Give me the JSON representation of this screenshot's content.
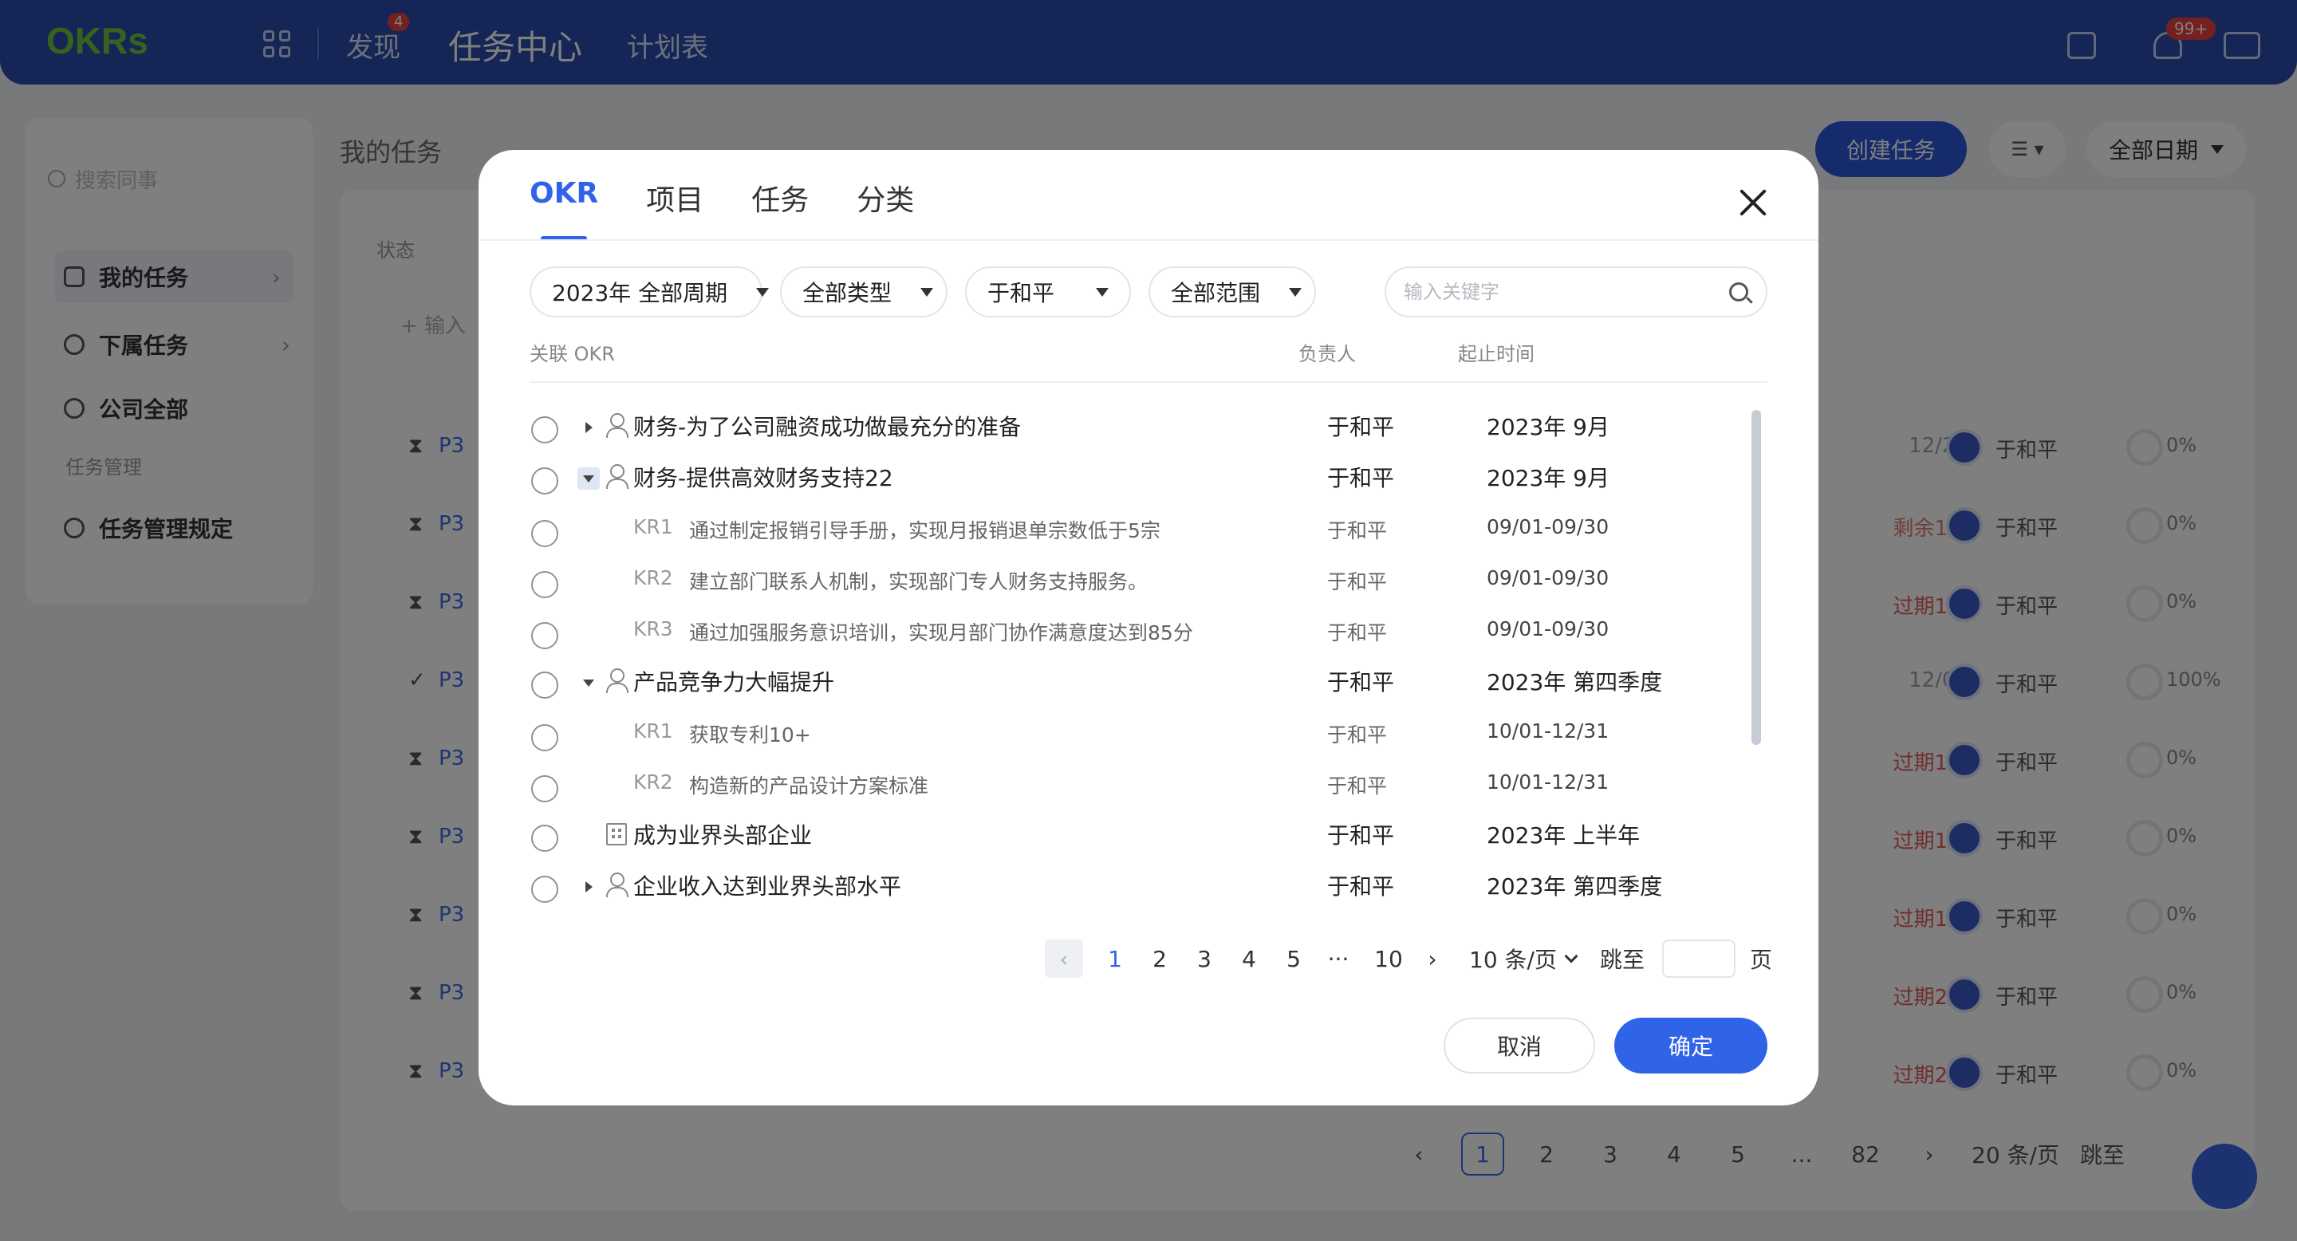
{
  "app": {
    "logo": "OKRs",
    "nav": [
      {
        "label": "发现",
        "badge": "4"
      },
      {
        "label": "任务中心"
      },
      {
        "label": "计划表"
      }
    ],
    "notification_badge": "99+"
  },
  "sidebar": {
    "search_placeholder": "搜索同事",
    "items": [
      {
        "label": "我的任务"
      },
      {
        "label": "下属任务"
      },
      {
        "label": "公司全部"
      }
    ],
    "group_label": "任务管理",
    "rule_item": "任务管理规定"
  },
  "main": {
    "title": "我的任务",
    "status_filter": "状态",
    "add_placeholder": "+ 输入",
    "create_button": "创建任务",
    "list_button": "☰ ▾",
    "date_filter": "全部日期",
    "rows": [
      {
        "prefix": "P3",
        "date": "12/29",
        "owner": "于和平",
        "progress": "0%",
        "date_color": "#9aa0aa"
      },
      {
        "prefix": "P3",
        "date": "剩余1天",
        "owner": "于和平",
        "progress": "0%",
        "date_color": "#e07b7b"
      },
      {
        "prefix": "P3",
        "date": "过期1天",
        "owner": "于和平",
        "progress": "0%",
        "date_color": "#e25a5a"
      },
      {
        "prefix": "P3",
        "date": "12/07",
        "owner": "于和平",
        "progress": "100%",
        "date_color": "#9aa0aa"
      },
      {
        "prefix": "P3",
        "date": "过期1天",
        "owner": "于和平",
        "progress": "0%",
        "date_color": "#e25a5a"
      },
      {
        "prefix": "P3",
        "date": "过期1天",
        "owner": "于和平",
        "progress": "0%",
        "date_color": "#e25a5a"
      },
      {
        "prefix": "P3",
        "date": "过期1天",
        "owner": "于和平",
        "progress": "0%",
        "date_color": "#e25a5a"
      },
      {
        "prefix": "P3",
        "date": "过期2天",
        "owner": "于和平",
        "progress": "0%",
        "date_color": "#e25a5a"
      },
      {
        "prefix": "P3",
        "date": "过期2天",
        "owner": "于和平",
        "progress": "0%",
        "date_color": "#e25a5a"
      }
    ],
    "pager": {
      "pages": [
        "1",
        "2",
        "3",
        "4",
        "5",
        "...",
        "82"
      ],
      "size": "20 条/页",
      "jump": "跳至"
    }
  },
  "modal": {
    "tabs": [
      "OKR",
      "项目",
      "任务",
      "分类"
    ],
    "active_tab": "OKR",
    "filters": [
      "2023年 全部周期",
      "全部类型",
      "于和平",
      "全部范围"
    ],
    "search_placeholder": "输入关键字",
    "columns": {
      "okr": "关联 OKR",
      "owner": "负责人",
      "period": "起止时间"
    },
    "rows": [
      {
        "type": "objective",
        "icon": "person-icon",
        "expander": "collapsed",
        "title": "财务-为了公司融资成功做最充分的准备",
        "owner": "于和平",
        "period": "2023年 9月"
      },
      {
        "type": "objective",
        "icon": "person-icon",
        "expander": "expanded-active",
        "title": "财务-提供高效财务支持22",
        "owner": "于和平",
        "period": "2023年 9月"
      },
      {
        "type": "kr",
        "tag": "KR1",
        "title": "通过制定报销引导手册，实现月报销退单宗数低于5宗",
        "owner": "于和平",
        "period": "09/01-09/30"
      },
      {
        "type": "kr",
        "tag": "KR2",
        "title": "建立部门联系人机制，实现部门专人财务支持服务。",
        "owner": "于和平",
        "period": "09/01-09/30"
      },
      {
        "type": "kr",
        "tag": "KR3",
        "title": "通过加强服务意识培训，实现月部门协作满意度达到85分",
        "owner": "于和平",
        "period": "09/01-09/30"
      },
      {
        "type": "objective",
        "icon": "person-icon",
        "expander": "expanded",
        "title": "产品竞争力大幅提升",
        "owner": "于和平",
        "period": "2023年 第四季度"
      },
      {
        "type": "kr",
        "tag": "KR1",
        "title": "获取专利10+",
        "owner": "于和平",
        "period": "10/01-12/31"
      },
      {
        "type": "kr",
        "tag": "KR2",
        "title": "构造新的产品设计方案标准",
        "owner": "于和平",
        "period": "10/01-12/31"
      },
      {
        "type": "objective",
        "icon": "building-icon",
        "expander": "none",
        "title": "成为业界头部企业",
        "owner": "于和平",
        "period": "2023年 上半年"
      },
      {
        "type": "objective",
        "icon": "person-icon",
        "expander": "collapsed",
        "title": "企业收入达到业界头部水平",
        "owner": "于和平",
        "period": "2023年 第四季度"
      }
    ],
    "pager": {
      "pages": [
        "1",
        "2",
        "3",
        "4",
        "5",
        "···",
        "10"
      ],
      "current": "1",
      "size": "10 条/页",
      "jump": "跳至",
      "unit": "页"
    },
    "cancel": "取消",
    "confirm": "确定"
  }
}
